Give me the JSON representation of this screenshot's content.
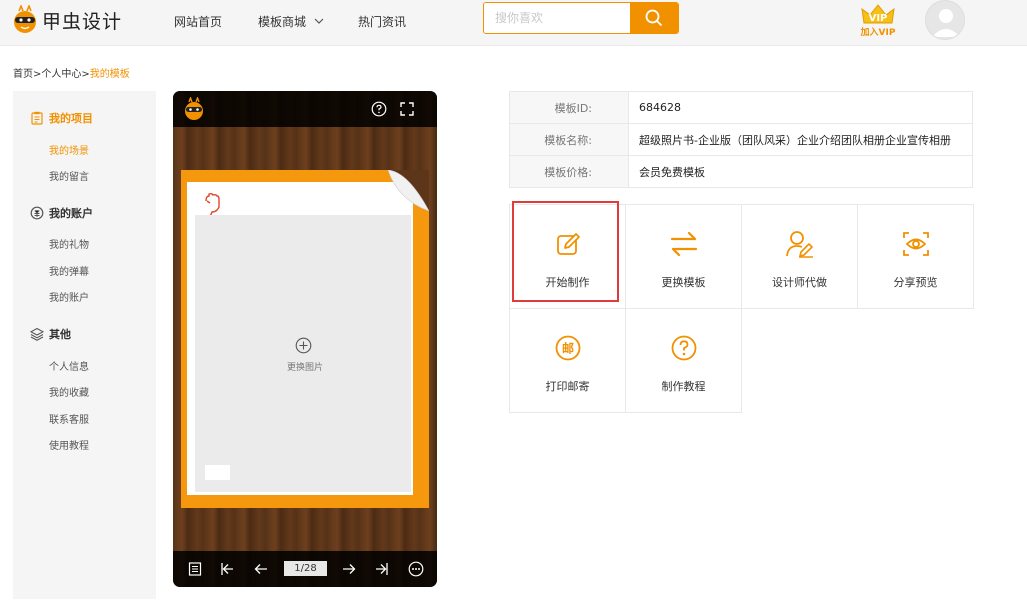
{
  "header": {
    "logo_text": "甲虫设计",
    "nav": [
      {
        "label": "网站首页"
      },
      {
        "label": "模板商城"
      },
      {
        "label": "热门资讯"
      }
    ],
    "search_placeholder": "搜你喜欢",
    "vip_label": "加入VIP",
    "accent_color": "#f29100"
  },
  "breadcrumb": {
    "items": [
      "首页",
      "个人中心"
    ],
    "separator": ">",
    "current": "我的模板"
  },
  "sidebar": {
    "groups": [
      {
        "title": "我的项目",
        "icon": "clipboard-icon",
        "items": [
          "我的场景",
          "我的留言"
        ]
      },
      {
        "title": "我的账户",
        "icon": "wallet-icon",
        "items": [
          "我的礼物",
          "我的弹幕",
          "我的账户"
        ]
      },
      {
        "title": "其他",
        "icon": "layers-icon",
        "items": [
          "个人信息",
          "我的收藏",
          "联系客服",
          "使用教程"
        ]
      }
    ]
  },
  "preview": {
    "photo_label": "更换图片",
    "page_indicator": "1/28"
  },
  "template_info": {
    "id_label": "模板ID:",
    "id_value": "684628",
    "name_label": "模板名称:",
    "name_value": "超级照片书-企业版（团队风采）企业介绍团队相册企业宣传相册",
    "price_label": "模板价格:",
    "price_value": "会员免费模板"
  },
  "actions": [
    {
      "label": "开始制作",
      "icon": "edit-icon"
    },
    {
      "label": "更换模板",
      "icon": "swap-icon"
    },
    {
      "label": "设计师代做",
      "icon": "designer-icon"
    },
    {
      "label": "分享预览",
      "icon": "eye-icon"
    },
    {
      "label": "打印邮寄",
      "icon": "mail-icon"
    },
    {
      "label": "制作教程",
      "icon": "help-icon"
    }
  ]
}
